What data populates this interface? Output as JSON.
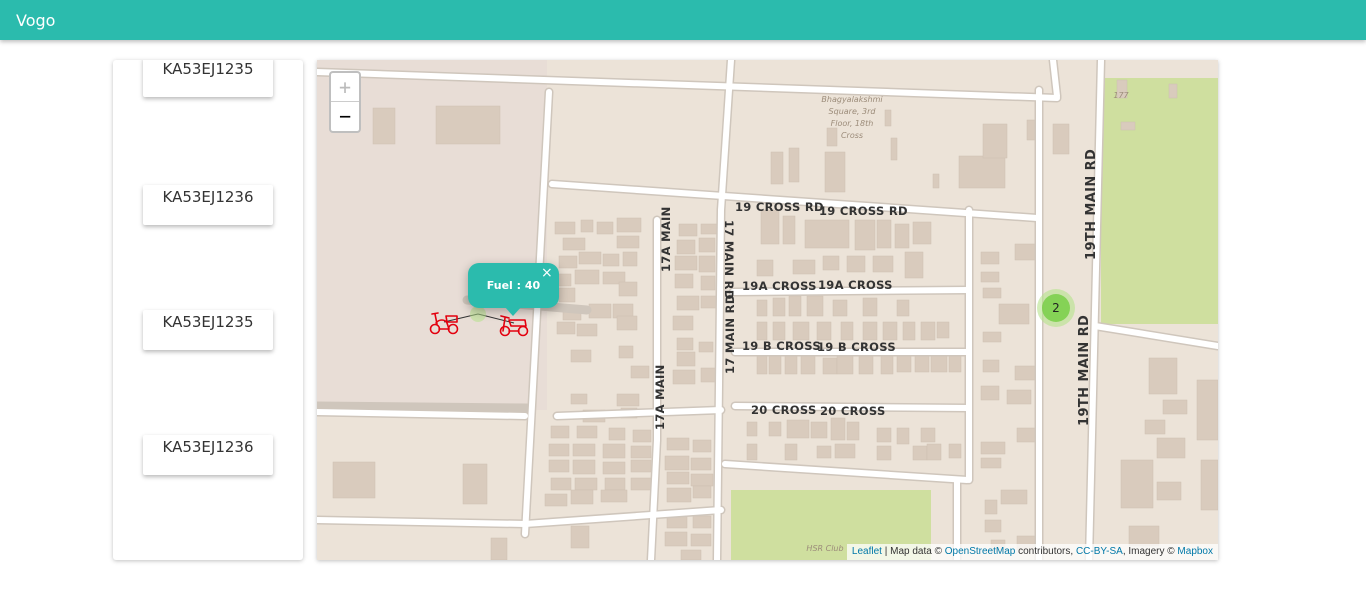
{
  "app": {
    "title": "Vogo"
  },
  "vehicles": [
    {
      "plate": "KA53EJ1235"
    },
    {
      "plate": "KA53EJ1236"
    },
    {
      "plate": "KA53EJ1235"
    },
    {
      "plate": "KA53EJ1236"
    }
  ],
  "map": {
    "zoom_in": "+",
    "zoom_out": "−",
    "popup": {
      "text": "Fuel : 40",
      "close": "×"
    },
    "cluster": {
      "count": "2"
    },
    "labels": {
      "landmark_line1": "Bhagyalakshmi",
      "landmark_line2": "Square, 3rd",
      "landmark_line3": "Floor, 18th",
      "landmark_line4": "Cross",
      "building_177": "177",
      "hsr_club": "HSR Club",
      "cross19_a": "19 CROSS RD",
      "cross19_b": "19 CROSS RD",
      "cross19a_a": "19A CROSS",
      "cross19a_b": "19A CROSS",
      "cross19b_a": "19 B CROSS",
      "cross19b_b": "19 B CROSS",
      "cross20_a": "20 CROSS",
      "cross20_b": "20 CROSS",
      "main17a_top": "17A MAIN",
      "main17a_bottom": "17A MAIN",
      "main17_top": "17 MAIN RD",
      "main17_bottom": "17 MAIN RD",
      "main19_top": "19TH MAIN RD",
      "main19_bottom": "19TH MAIN RD"
    },
    "attribution": {
      "leaflet": "Leaflet",
      "text1": " | Map data © ",
      "osm": "OpenStreetMap",
      "text2": " contributors, ",
      "license": "CC-BY-SA",
      "text3": ", Imagery © ",
      "mapbox": "Mapbox"
    },
    "colors": {
      "land": "#ece3d8",
      "road": "#ffffff",
      "building": "#d9cbbd",
      "park": "#cfdf9f",
      "scooter": "#e3000f",
      "accent": "#2bbbad"
    }
  }
}
